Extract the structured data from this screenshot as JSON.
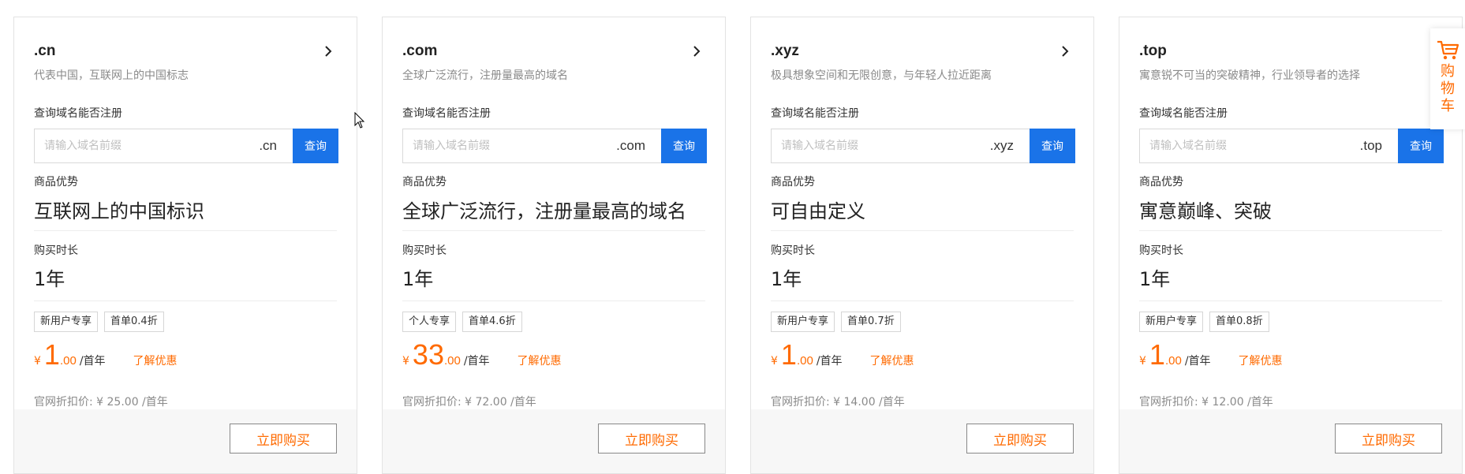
{
  "query_label": "查询域名能否注册",
  "search_placeholder": "请输入域名前缀",
  "search_button": "查询",
  "advantage_label": "商品优势",
  "duration_label": "购买时长",
  "promo_link": "了解优惠",
  "buy_button": "立即购买",
  "cart_label": "购物车",
  "colors": {
    "accent": "#ff6a00",
    "primary": "#1a73e8"
  },
  "cards": [
    {
      "title": ".cn",
      "desc": "代表中国，互联网上的中国标志",
      "suffix": ".cn",
      "advantage": "互联网上的中国标识",
      "duration": "1年",
      "tags": [
        "新用户专享",
        "首单0.4折"
      ],
      "currency": "¥",
      "price_int": "1",
      "price_dec": ".00",
      "price_unit": "/首年",
      "original": "官网折扣价: ¥ 25.00 /首年"
    },
    {
      "title": ".com",
      "desc": "全球广泛流行，注册量最高的域名",
      "suffix": ".com",
      "advantage": "全球广泛流行，注册量最高的域名",
      "duration": "1年",
      "tags": [
        "个人专享",
        "首单4.6折"
      ],
      "currency": "¥",
      "price_int": "33",
      "price_dec": ".00",
      "price_unit": "/首年",
      "original": "官网折扣价: ¥ 72.00 /首年"
    },
    {
      "title": ".xyz",
      "desc": "极具想象空间和无限创意，与年轻人拉近距离",
      "suffix": ".xyz",
      "advantage": "可自由定义",
      "duration": "1年",
      "tags": [
        "新用户专享",
        "首单0.7折"
      ],
      "currency": "¥",
      "price_int": "1",
      "price_dec": ".00",
      "price_unit": "/首年",
      "original": "官网折扣价: ¥ 14.00 /首年"
    },
    {
      "title": ".top",
      "desc": "寓意锐不可当的突破精神，行业领导者的选择",
      "suffix": ".top",
      "advantage": "寓意巅峰、突破",
      "duration": "1年",
      "tags": [
        "新用户专享",
        "首单0.8折"
      ],
      "currency": "¥",
      "price_int": "1",
      "price_dec": ".00",
      "price_unit": "/首年",
      "original": "官网折扣价: ¥ 12.00 /首年"
    }
  ]
}
